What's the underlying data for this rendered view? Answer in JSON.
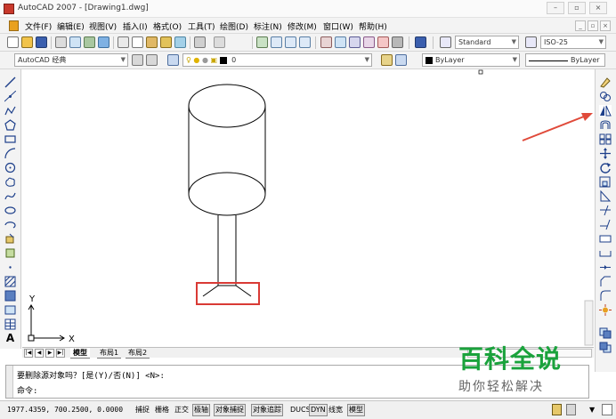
{
  "window": {
    "title": "AutoCAD 2007 - [Drawing1.dwg]",
    "controls": [
      "–",
      "▫",
      "×"
    ]
  },
  "menu": {
    "items": [
      "文件(F)",
      "编辑(E)",
      "视图(V)",
      "插入(I)",
      "格式(O)",
      "工具(T)",
      "绘图(D)",
      "标注(N)",
      "修改(M)",
      "窗口(W)",
      "帮助(H)"
    ],
    "mdi_controls": [
      "_",
      "▫",
      "×"
    ]
  },
  "toolbar": {
    "text_style": "Standard",
    "dim_style": "ISO-25",
    "workspace": "AutoCAD 经典",
    "layer": "0",
    "color": "ByLayer",
    "linetype": "ByLayer"
  },
  "drawing": {
    "ucs_x": "X",
    "ucs_y": "Y"
  },
  "tabs": {
    "nav": [
      "|◀",
      "◀",
      "▶",
      "▶|"
    ],
    "items": [
      "模型",
      "布局1",
      "布局2"
    ]
  },
  "command": {
    "line1": "要删除源对象吗？[是(Y)/否(N)] <N>:",
    "line2": "命令:"
  },
  "status": {
    "coords": "1977.4359, 700.2500, 0.0000",
    "buttons": [
      "捕捉",
      "栅格",
      "正交",
      "极轴",
      "对象捕捉",
      "对象追踪",
      "DUCS",
      "DYN",
      "线宽",
      "模型"
    ]
  },
  "watermark": {
    "title": "百科全说",
    "subtitle": "助你轻松解决"
  },
  "colors": {
    "highlight_box": "#d93a35",
    "arrow": "#e04a3a",
    "watermark": "#1aa23c"
  }
}
